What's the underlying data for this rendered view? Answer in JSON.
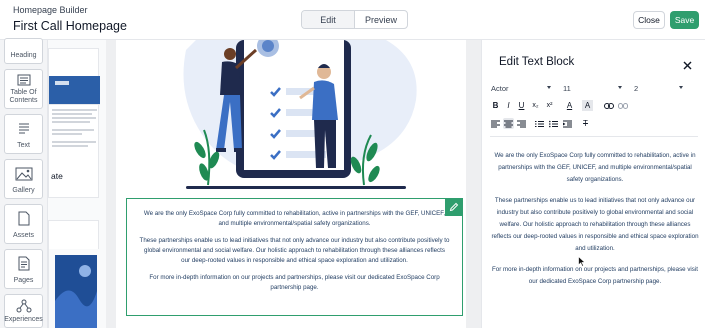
{
  "header": {
    "app_title": "Homepage Builder",
    "page_name": "First Call Homepage",
    "mode_tabs": [
      "Edit",
      "Preview"
    ],
    "active_mode": "Edit",
    "close_label": "Close",
    "save_label": "Save",
    "save_color": "#2f9e6e"
  },
  "rail": {
    "tools": [
      {
        "label": "Heading",
        "icon": "heading-icon"
      },
      {
        "label": "Table Of Contents",
        "icon": "toc-icon"
      },
      {
        "label": "Text",
        "icon": "text-icon"
      },
      {
        "label": "Gallery",
        "icon": "image-icon"
      },
      {
        "label": "Assets",
        "icon": "file-icon"
      },
      {
        "label": "Pages",
        "icon": "pages-icon"
      },
      {
        "label": "Experiences",
        "icon": "experiences-icon"
      }
    ]
  },
  "templates": {
    "partial_label": "ate"
  },
  "canvas": {
    "text_block": {
      "paragraphs": [
        "We are the only ExoSpace Corp fully committed to rehabilitation, active in partnerships with the GEF, UNICEF, and multiple environmental/spatial safety organizations.",
        "These partnerships enable us to lead initiatives that not only advance our industry but also contribute positively to global environmental and social welfare. Our holistic approach to rehabilitation through these alliances reflects our deep-rooted values in responsible and ethical space exploration and utilization.",
        "For more in-depth information on our projects and partnerships, please visit our dedicated ExoSpace Corp partnership page."
      ]
    }
  },
  "panel": {
    "title": "Edit Text Block",
    "font_family": "Actor",
    "font_size": "11",
    "line_height": "2",
    "toolbar": {
      "bold": "B",
      "italic": "I",
      "underline": "U",
      "subscript": "x₂",
      "superscript": "x²",
      "text_color": "A",
      "highlight": "A",
      "clear_format": "T"
    },
    "preview": {
      "paragraphs": [
        "We are the only ExoSpace Corp fully committed to rehabilitation, active in partnerships with the GEF, UNICEF, and multiple environmental/spatial safety organizations.",
        "These partnerships enable us to lead initiatives that not only advance our industry but also contribute positively to global environmental and social welfare. Our holistic approach to rehabilitation through these alliances reflects our deep-rooted values in responsible and ethical space exploration and utilization.",
        "For more in-depth information on our projects and partnerships, please visit our dedicated ExoSpace Corp partnership page."
      ]
    }
  },
  "colors": {
    "accent": "#2f9e6e",
    "text_navy": "#1e3a5f",
    "illustration_navy": "#1f2a4d",
    "illustration_blue": "#3b6fc4",
    "illustration_green": "#1f8a53"
  }
}
